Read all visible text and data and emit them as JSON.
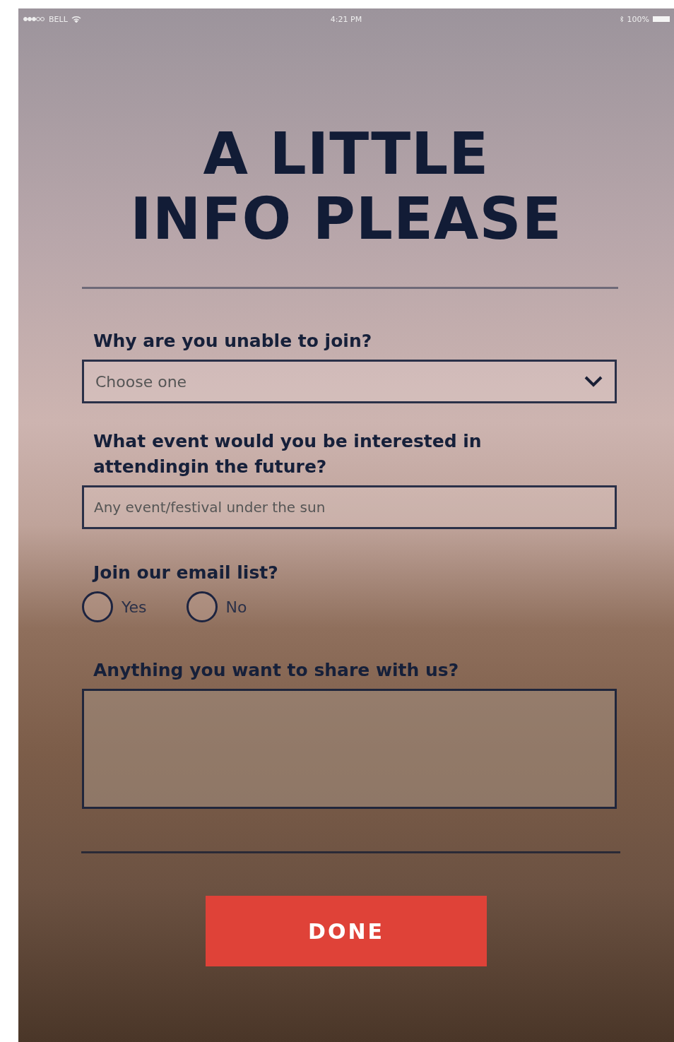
{
  "status_bar": {
    "carrier": "BELL",
    "time": "4:21 PM",
    "battery": "100%"
  },
  "title": [
    "A LITTLE",
    "INFO PLEASE"
  ],
  "fields": [
    {
      "kind": "select",
      "label": "Why are you unable to join?",
      "placeholder": "Choose one"
    },
    {
      "kind": "text",
      "label": "What event would you be interested in attendingin the future?",
      "placeholder": "Any event/festival under the sun"
    },
    {
      "kind": "radio",
      "label": "Join our email list?",
      "options": [
        {
          "label": "Yes",
          "selected": false
        },
        {
          "label": "No",
          "selected": false
        }
      ]
    },
    {
      "kind": "textarea",
      "label": "Anything you want to share with us?"
    }
  ],
  "button": "DONE"
}
